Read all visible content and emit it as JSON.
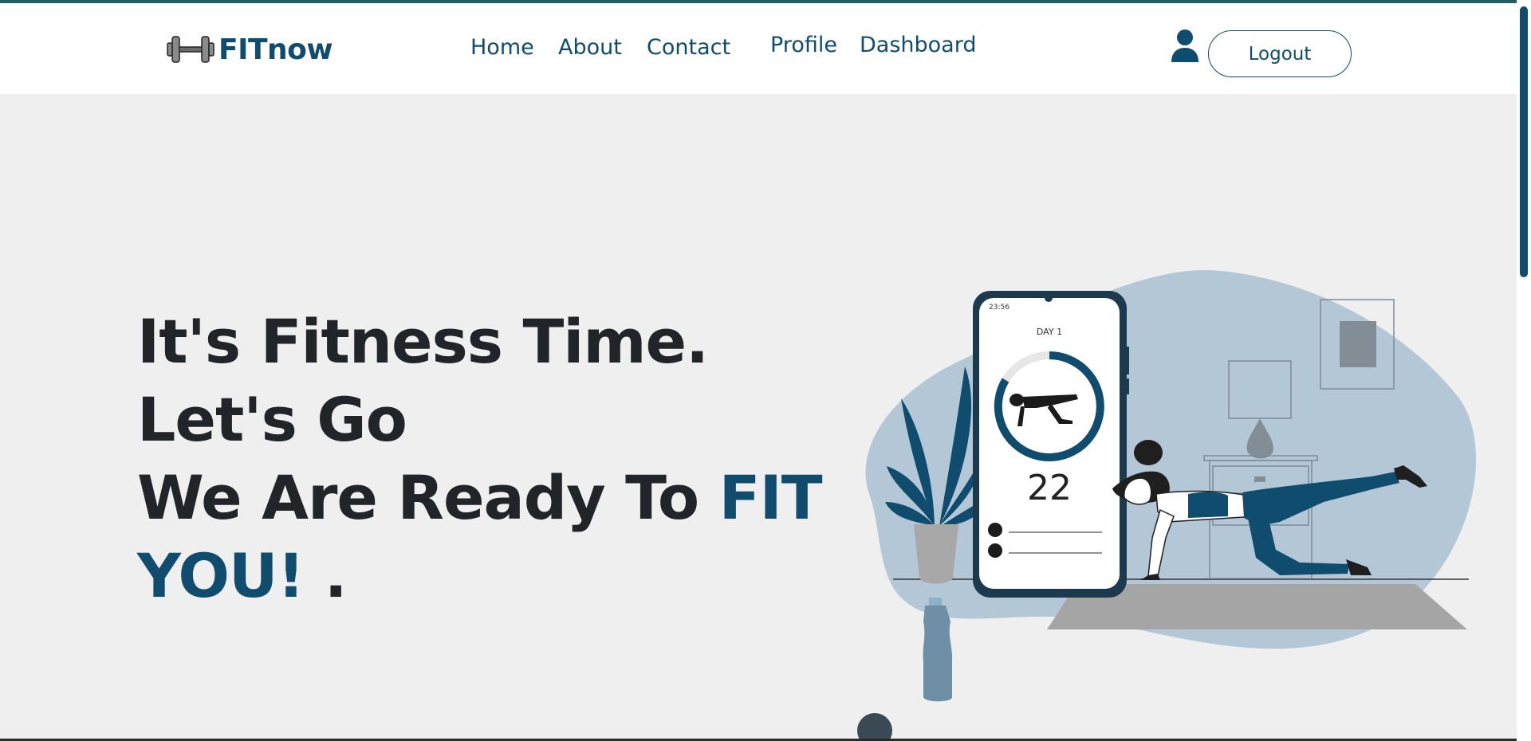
{
  "brand": {
    "name": "FITnow",
    "icon": "dumbbell-icon"
  },
  "nav": {
    "links": [
      {
        "label": "Home"
      },
      {
        "label": "About"
      },
      {
        "label": "Contact"
      },
      {
        "label": "Profile"
      },
      {
        "label": "Dashboard"
      }
    ],
    "user_icon": "user-icon",
    "logout_label": "Logout"
  },
  "hero": {
    "line1": "It's Fitness Time.",
    "line2": "Let's Go",
    "line3_prefix": "We Are Ready To ",
    "line3_accent": "FIT",
    "line4_accent": "YOU!",
    "line4_suffix": " ."
  },
  "illustration": {
    "phone_time": "23:56",
    "phone_day": "DAY 1",
    "phone_counter": "22"
  },
  "colors": {
    "accent": "#0f4c6e",
    "text": "#212529",
    "background": "#efefef",
    "blob": "#b3c7d6",
    "topline": "#1f5e63"
  }
}
